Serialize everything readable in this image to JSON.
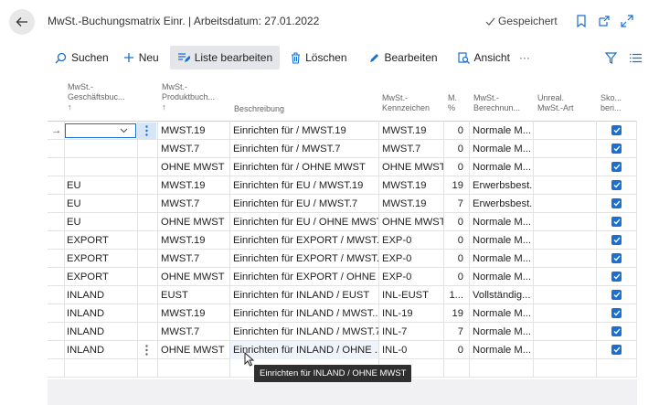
{
  "header": {
    "title": "MwSt.-Buchungsmatrix Einr. | Arbeitsdatum: 27.01.2022",
    "saved_label": "Gespeichert"
  },
  "toolbar": {
    "search": "Suchen",
    "new": "Neu",
    "edit_list": "Liste bearbeiten",
    "delete": "Löschen",
    "edit": "Bearbeiten",
    "view": "Ansicht",
    "more": "···"
  },
  "columns": {
    "gen_bus": [
      "MwSt.-",
      "Geschäftsbuc...",
      "↑"
    ],
    "prod": [
      "MwSt.-",
      "Produktbuch...",
      "↑"
    ],
    "desc": "Beschreibung",
    "ident": [
      "MwSt.-",
      "Kennzeichen"
    ],
    "pct": [
      "M.",
      "%"
    ],
    "calc": [
      "MwSt.-",
      "Berechnun..."
    ],
    "unreal": [
      "Unreal.",
      "MwSt.-Art"
    ],
    "sko": [
      "Sko...",
      "beri..."
    ]
  },
  "rows": [
    {
      "bus": "",
      "prod": "MWST.19",
      "desc": "Einrichten für  / MWST.19",
      "ident": "MWST.19",
      "pct": "0",
      "calc": "Normale M..."
    },
    {
      "bus": "",
      "prod": "MWST.7",
      "desc": "Einrichten für  / MWST.7",
      "ident": "MWST.7",
      "pct": "0",
      "calc": "Normale M..."
    },
    {
      "bus": "",
      "prod": "OHNE MWST",
      "desc": "Einrichten für  / OHNE MWST",
      "ident": "OHNE MWST",
      "pct": "0",
      "calc": "Normale M..."
    },
    {
      "bus": "EU",
      "prod": "MWST.19",
      "desc": "Einrichten für EU / MWST.19",
      "ident": "MWST.19",
      "pct": "19",
      "calc": "Erwerbsbest..."
    },
    {
      "bus": "EU",
      "prod": "MWST.7",
      "desc": "Einrichten für EU / MWST.7",
      "ident": "MWST.19",
      "pct": "7",
      "calc": "Erwerbsbest..."
    },
    {
      "bus": "EU",
      "prod": "OHNE MWST",
      "desc": "Einrichten für EU / OHNE MWST",
      "ident": "OHNE MWST",
      "pct": "0",
      "calc": "Normale M..."
    },
    {
      "bus": "EXPORT",
      "prod": "MWST.19",
      "desc": "Einrichten für EXPORT / MWST....",
      "ident": "EXP-0",
      "pct": "0",
      "calc": "Normale M..."
    },
    {
      "bus": "EXPORT",
      "prod": "MWST.7",
      "desc": "Einrichten für EXPORT / MWST.7",
      "ident": "EXP-0",
      "pct": "0",
      "calc": "Normale M..."
    },
    {
      "bus": "EXPORT",
      "prod": "OHNE MWST",
      "desc": "Einrichten für EXPORT / OHNE ...",
      "ident": "EXP-0",
      "pct": "0",
      "calc": "Normale M..."
    },
    {
      "bus": "INLAND",
      "prod": "EUST",
      "desc": "Einrichten für INLAND / EUST",
      "ident": "INL-EUST",
      "pct": "1...",
      "calc": "Vollständig..."
    },
    {
      "bus": "INLAND",
      "prod": "MWST.19",
      "desc": "Einrichten für INLAND / MWST....",
      "ident": "INL-19",
      "pct": "19",
      "calc": "Normale M..."
    },
    {
      "bus": "INLAND",
      "prod": "MWST.7",
      "desc": "Einrichten für INLAND / MWST.7",
      "ident": "INL-7",
      "pct": "7",
      "calc": "Normale M..."
    },
    {
      "bus": "INLAND",
      "prod": "OHNE MWST",
      "desc": "Einrichten für INLAND / OHNE ...",
      "ident": "INL-0",
      "pct": "0",
      "calc": "Normale M..."
    }
  ],
  "tooltip": "Einrichten für INLAND / OHNE MWST",
  "colors": {
    "accent": "#1a6fd4",
    "active_bg": "#e4e6ea",
    "selected_cell": "#d6e6f6"
  }
}
